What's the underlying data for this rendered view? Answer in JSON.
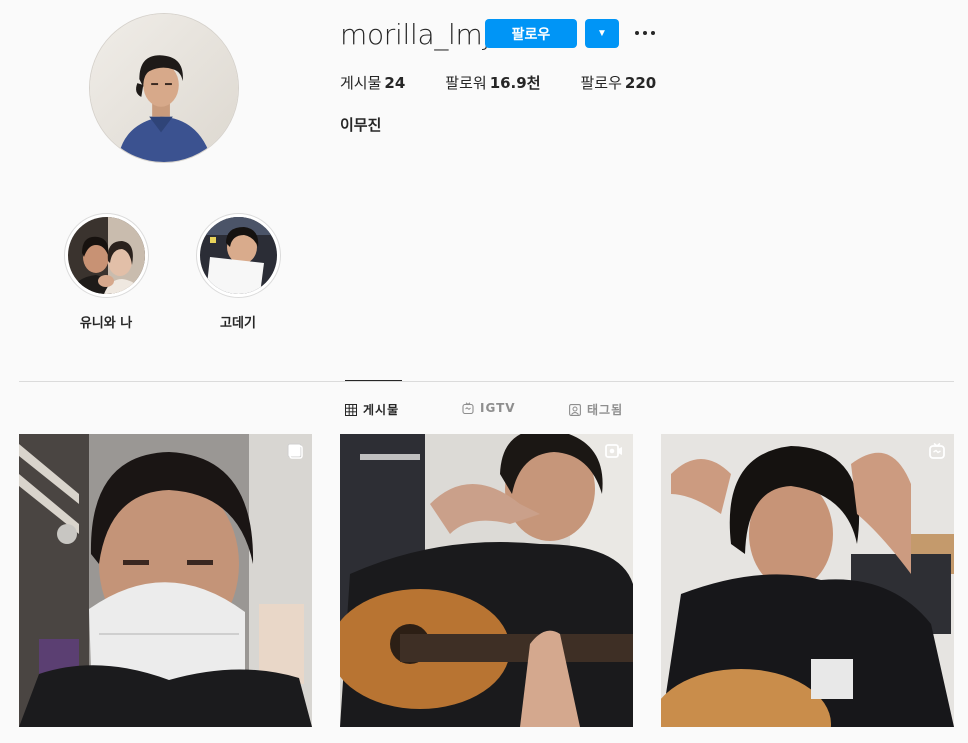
{
  "profile": {
    "username": "morilla_lmj",
    "follow_label": "팔로우",
    "dropdown_icon": "▼",
    "more_icon": "more-options-icon",
    "stats": [
      {
        "label": "게시물",
        "value": "24"
      },
      {
        "label": "팔로워",
        "value": "16.9천"
      },
      {
        "label": "팔로우",
        "value": "220"
      }
    ],
    "full_name": "이무진"
  },
  "highlights": [
    {
      "label": "유니와 나"
    },
    {
      "label": "고데기"
    }
  ],
  "tabs": [
    {
      "label": "게시물",
      "icon": "grid-icon",
      "active": true
    },
    {
      "label": "IGTV",
      "icon": "igtv-icon",
      "active": false
    },
    {
      "label": "태그됨",
      "icon": "tagged-icon",
      "active": false
    }
  ],
  "posts": [
    {
      "type": "carousel",
      "badge_icon": "carousel-icon"
    },
    {
      "type": "video",
      "badge_icon": "video-icon"
    },
    {
      "type": "igtv",
      "badge_icon": "igtv-icon"
    }
  ],
  "colors": {
    "accent": "#0095f6",
    "background": "#fafafa",
    "text": "#262626",
    "muted": "#8e8e8e",
    "border": "#dbdbdb"
  }
}
